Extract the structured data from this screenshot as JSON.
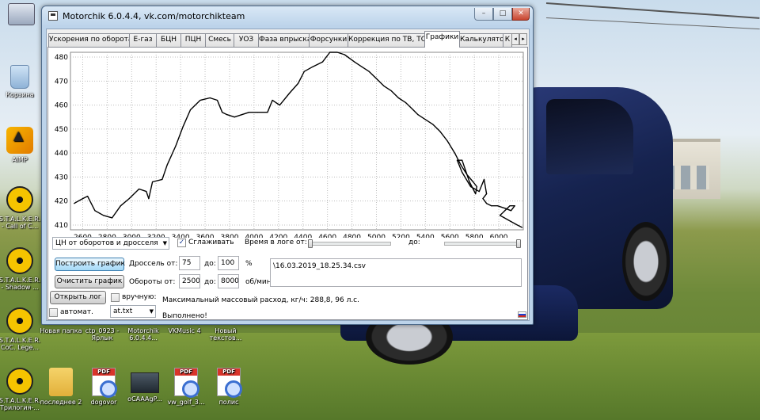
{
  "desktop": {
    "icons": [
      {
        "label": "",
        "glyph": "computer-icon"
      },
      {
        "label": "Корзина",
        "glyph": "recycle-bin-icon"
      },
      {
        "label": "AIMP",
        "glyph": "aimp-icon"
      },
      {
        "label": "S.T.A.L.K.E.R. - Call of C...",
        "glyph": "stalker-icon"
      },
      {
        "label": "S.T.A.L.K.E.R. - Shadow ...",
        "glyph": "stalker-icon"
      },
      {
        "label": "S.T.A.L.K.E.R. CoC. Lege...",
        "glyph": "stalker-icon"
      },
      {
        "label": "S.T.A.L.K.E.R. Трилогия-...",
        "glyph": "stalker-icon"
      },
      {
        "label": "Новая папка",
        "glyph": "folder-icon"
      },
      {
        "label": "ctp_0923 - Ярлык",
        "glyph": "shortcut-icon"
      },
      {
        "label": "Motorchik 6.0.4.4...",
        "glyph": "app-icon"
      },
      {
        "label": "VKMusic 4",
        "glyph": "app-icon"
      },
      {
        "label": "Новый текстов...",
        "glyph": "text-file-icon"
      },
      {
        "label": "последнее 2",
        "glyph": "folder-icon"
      },
      {
        "label": "dogovor",
        "glyph": "pdf-icon"
      },
      {
        "label": "oCAAAgP...",
        "glyph": "car-image-icon"
      },
      {
        "label": "vw_golf_3...",
        "glyph": "pdf-icon"
      },
      {
        "label": "полис",
        "glyph": "pdf-icon"
      }
    ]
  },
  "window": {
    "title": "Motorchik 6.0.4.4, vk.com/motorchikteam",
    "controls": {
      "minimize": "–",
      "maximize": "□",
      "close": "✕"
    }
  },
  "tabs": [
    "Ускорения по оборотам",
    "E-газ",
    "БЦН",
    "ПЦН",
    "Смесь",
    "УОЗ",
    "Фаза впрыска",
    "Форсунки",
    "Коррекция по ТВ, ТОЖ",
    "Графики",
    "Калькулятор",
    "К"
  ],
  "active_tab": "Графики",
  "chart_data": {
    "type": "line",
    "title": "",
    "xlabel": "",
    "ylabel": "",
    "xlim": [
      2500,
      6200
    ],
    "ylim": [
      408,
      482
    ],
    "x_ticks": [
      2600,
      2800,
      3000,
      3200,
      3400,
      3600,
      3800,
      4000,
      4200,
      4400,
      4600,
      4800,
      5000,
      5200,
      5400,
      5600,
      5800,
      6000
    ],
    "y_ticks": [
      410,
      420,
      430,
      440,
      450,
      460,
      470,
      480
    ],
    "grid": true,
    "series": [
      {
        "color": "#000000",
        "x": [
          2530,
          2600,
          2640,
          2700,
          2770,
          2840,
          2910,
          2980,
          3060,
          3120,
          3140,
          3170,
          3250,
          3290,
          3360,
          3420,
          3480,
          3560,
          3640,
          3700,
          3740,
          3780,
          3840,
          3900,
          3960,
          4030,
          4110,
          4150,
          4180,
          4210,
          4290,
          4360,
          4410,
          4480,
          4560,
          4620,
          4680,
          4740,
          4820,
          4880,
          4940,
          5000,
          5060,
          5120,
          5180,
          5240,
          5300,
          5340,
          5400,
          5460,
          5520,
          5580,
          5640,
          5690,
          5740,
          5790,
          5820,
          5810,
          5760,
          5700,
          5660,
          5700,
          5770,
          5840,
          5880,
          5900,
          5870,
          5900,
          5940,
          5990,
          6050,
          6100,
          6130,
          6090,
          6050,
          6010,
          6080,
          6150,
          6190
        ],
        "y": [
          419,
          421,
          422,
          416,
          414,
          413,
          418,
          421,
          425,
          424,
          421,
          428,
          429,
          435,
          443,
          451,
          458,
          462,
          463,
          462,
          457,
          456,
          455,
          456,
          457,
          457,
          457,
          462,
          461,
          460,
          465,
          469,
          474,
          476,
          478,
          482,
          482,
          481,
          478,
          476,
          474,
          471,
          468,
          466,
          463,
          461,
          458,
          456,
          454,
          452,
          449,
          445,
          440,
          435,
          431,
          428,
          426,
          423,
          428,
          437,
          437,
          432,
          426,
          424,
          429,
          423,
          421,
          419,
          418,
          418,
          417,
          416,
          418,
          418,
          416,
          414,
          412,
          410,
          409
        ]
      }
    ]
  },
  "controls": {
    "mode_select": "ЦН от оборотов и дросселя",
    "smooth_label": "Сглаживать",
    "smooth_checked": true,
    "log_time_label": "Время в логе от:",
    "log_time_to_label": "до:",
    "log_time_from_pos": 0.0,
    "log_time_to_pos": 1.0,
    "build_button": "Построить график",
    "clear_button": "Очистить график",
    "throttle_label": "Дроссель от:",
    "throttle_from": "75",
    "throttle_to_label": "до:",
    "throttle_to": "100",
    "throttle_unit": "%",
    "rpm_label": "Обороты от:",
    "rpm_from": "2500",
    "rpm_to_label": "до:",
    "rpm_to": "8000",
    "rpm_unit": "об/мин",
    "log_file": "\\16.03.2019_18.25.34.csv"
  },
  "statusbar": {
    "open_log_button": "Открыть лог",
    "manual_label": "вручную:",
    "manual_checked": false,
    "auto_label": "автомат.",
    "auto_checked": false,
    "file_select": "at.txt",
    "max_flow_text": "Максимальный массовый расход, кг/ч: 288,8, 96 л.с.",
    "status_text": "Выполнено!",
    "language": "ru"
  }
}
